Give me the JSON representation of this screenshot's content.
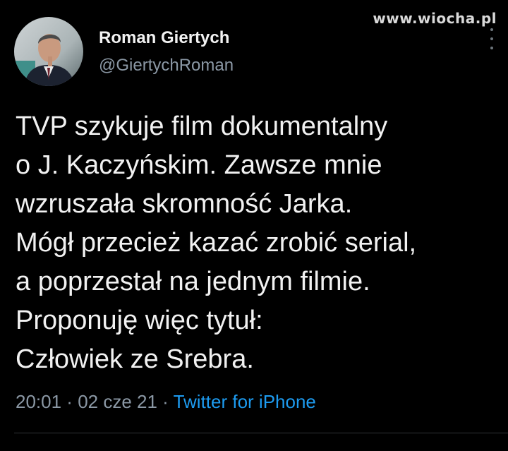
{
  "watermark": "www.wiocha.pl",
  "author": {
    "display_name": "Roman Giertych",
    "handle": "@GiertychRoman"
  },
  "tweet": {
    "lines": [
      "TVP szykuje film dokumentalny",
      "o J. Kaczyńskim. Zawsze mnie",
      "wzruszała skromność Jarka.",
      "Mógł przecież kazać zrobić serial,",
      "a poprzestał na jednym filmie.",
      "Proponuję więc tytuł:",
      "Człowiek ze Srebra."
    ]
  },
  "meta": {
    "time": "20:01",
    "separator": " · ",
    "date": "02 cze 21",
    "source": "Twitter for iPhone"
  },
  "icons": {
    "more": "more-vertical-icon"
  },
  "colors": {
    "background": "#000000",
    "text": "#f1f1f1",
    "secondary": "#8b98a5",
    "link": "#1d9bf0"
  }
}
